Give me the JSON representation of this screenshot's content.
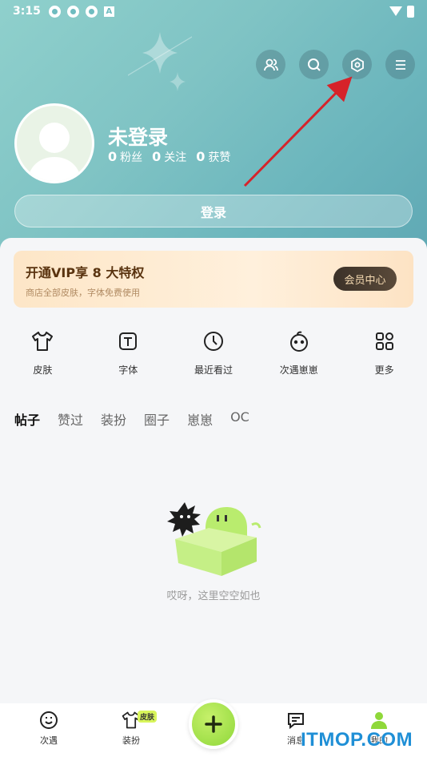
{
  "status": {
    "time": "3:15",
    "badge": "A"
  },
  "profile": {
    "username": "未登录",
    "stats": [
      {
        "num": "0",
        "label": "粉丝"
      },
      {
        "num": "0",
        "label": "关注"
      },
      {
        "num": "0",
        "label": "获赞"
      }
    ],
    "login_label": "登录"
  },
  "header_icons": [
    "user-group-icon",
    "search-icon",
    "settings-icon",
    "menu-icon"
  ],
  "vip": {
    "title": "开通VIP享 8 大特权",
    "subtitle": "商店全部皮肤，字体免费使用",
    "button": "会员中心",
    "colors": {
      "bg": "#fde6c7",
      "button": "#3b3128",
      "button_text": "#f7dcb3"
    }
  },
  "quick": [
    {
      "label": "皮肤",
      "icon": "tshirt-icon"
    },
    {
      "label": "字体",
      "icon": "font-icon"
    },
    {
      "label": "最近看过",
      "icon": "clock-icon"
    },
    {
      "label": "次遇崽崽",
      "icon": "pet-icon"
    },
    {
      "label": "更多",
      "icon": "grid-icon"
    }
  ],
  "tabs": [
    "帖子",
    "赞过",
    "装扮",
    "圈子",
    "崽崽",
    "OC"
  ],
  "empty_text": "哎呀，这里空空如也",
  "nav": {
    "items": [
      {
        "label": "次遇",
        "icon": "smile-icon"
      },
      {
        "label": "装扮",
        "icon": "tshirt-icon"
      },
      {
        "label": "消息",
        "icon": "message-icon"
      },
      {
        "label": "我的",
        "icon": "person-icon"
      }
    ],
    "skin_badge": "皮肤",
    "fab": "+"
  },
  "watermark": "ITMOP.COM",
  "colors": {
    "accent_green": "#b7ea6b",
    "arrow": "#d6232a",
    "header": "#7fc3c4"
  }
}
